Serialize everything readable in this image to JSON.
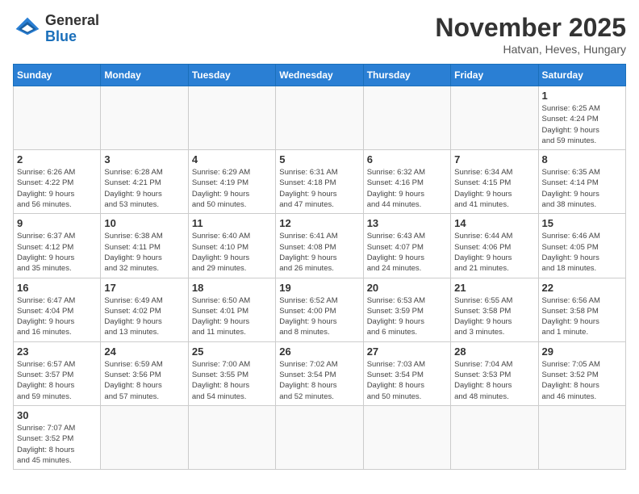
{
  "header": {
    "logo_general": "General",
    "logo_blue": "Blue",
    "month_year": "November 2025",
    "location": "Hatvan, Heves, Hungary"
  },
  "weekdays": [
    "Sunday",
    "Monday",
    "Tuesday",
    "Wednesday",
    "Thursday",
    "Friday",
    "Saturday"
  ],
  "weeks": [
    [
      {
        "day": "",
        "info": ""
      },
      {
        "day": "",
        "info": ""
      },
      {
        "day": "",
        "info": ""
      },
      {
        "day": "",
        "info": ""
      },
      {
        "day": "",
        "info": ""
      },
      {
        "day": "",
        "info": ""
      },
      {
        "day": "1",
        "info": "Sunrise: 6:25 AM\nSunset: 4:24 PM\nDaylight: 9 hours\nand 59 minutes."
      }
    ],
    [
      {
        "day": "2",
        "info": "Sunrise: 6:26 AM\nSunset: 4:22 PM\nDaylight: 9 hours\nand 56 minutes."
      },
      {
        "day": "3",
        "info": "Sunrise: 6:28 AM\nSunset: 4:21 PM\nDaylight: 9 hours\nand 53 minutes."
      },
      {
        "day": "4",
        "info": "Sunrise: 6:29 AM\nSunset: 4:19 PM\nDaylight: 9 hours\nand 50 minutes."
      },
      {
        "day": "5",
        "info": "Sunrise: 6:31 AM\nSunset: 4:18 PM\nDaylight: 9 hours\nand 47 minutes."
      },
      {
        "day": "6",
        "info": "Sunrise: 6:32 AM\nSunset: 4:16 PM\nDaylight: 9 hours\nand 44 minutes."
      },
      {
        "day": "7",
        "info": "Sunrise: 6:34 AM\nSunset: 4:15 PM\nDaylight: 9 hours\nand 41 minutes."
      },
      {
        "day": "8",
        "info": "Sunrise: 6:35 AM\nSunset: 4:14 PM\nDaylight: 9 hours\nand 38 minutes."
      }
    ],
    [
      {
        "day": "9",
        "info": "Sunrise: 6:37 AM\nSunset: 4:12 PM\nDaylight: 9 hours\nand 35 minutes."
      },
      {
        "day": "10",
        "info": "Sunrise: 6:38 AM\nSunset: 4:11 PM\nDaylight: 9 hours\nand 32 minutes."
      },
      {
        "day": "11",
        "info": "Sunrise: 6:40 AM\nSunset: 4:10 PM\nDaylight: 9 hours\nand 29 minutes."
      },
      {
        "day": "12",
        "info": "Sunrise: 6:41 AM\nSunset: 4:08 PM\nDaylight: 9 hours\nand 26 minutes."
      },
      {
        "day": "13",
        "info": "Sunrise: 6:43 AM\nSunset: 4:07 PM\nDaylight: 9 hours\nand 24 minutes."
      },
      {
        "day": "14",
        "info": "Sunrise: 6:44 AM\nSunset: 4:06 PM\nDaylight: 9 hours\nand 21 minutes."
      },
      {
        "day": "15",
        "info": "Sunrise: 6:46 AM\nSunset: 4:05 PM\nDaylight: 9 hours\nand 18 minutes."
      }
    ],
    [
      {
        "day": "16",
        "info": "Sunrise: 6:47 AM\nSunset: 4:04 PM\nDaylight: 9 hours\nand 16 minutes."
      },
      {
        "day": "17",
        "info": "Sunrise: 6:49 AM\nSunset: 4:02 PM\nDaylight: 9 hours\nand 13 minutes."
      },
      {
        "day": "18",
        "info": "Sunrise: 6:50 AM\nSunset: 4:01 PM\nDaylight: 9 hours\nand 11 minutes."
      },
      {
        "day": "19",
        "info": "Sunrise: 6:52 AM\nSunset: 4:00 PM\nDaylight: 9 hours\nand 8 minutes."
      },
      {
        "day": "20",
        "info": "Sunrise: 6:53 AM\nSunset: 3:59 PM\nDaylight: 9 hours\nand 6 minutes."
      },
      {
        "day": "21",
        "info": "Sunrise: 6:55 AM\nSunset: 3:58 PM\nDaylight: 9 hours\nand 3 minutes."
      },
      {
        "day": "22",
        "info": "Sunrise: 6:56 AM\nSunset: 3:58 PM\nDaylight: 9 hours\nand 1 minute."
      }
    ],
    [
      {
        "day": "23",
        "info": "Sunrise: 6:57 AM\nSunset: 3:57 PM\nDaylight: 8 hours\nand 59 minutes."
      },
      {
        "day": "24",
        "info": "Sunrise: 6:59 AM\nSunset: 3:56 PM\nDaylight: 8 hours\nand 57 minutes."
      },
      {
        "day": "25",
        "info": "Sunrise: 7:00 AM\nSunset: 3:55 PM\nDaylight: 8 hours\nand 54 minutes."
      },
      {
        "day": "26",
        "info": "Sunrise: 7:02 AM\nSunset: 3:54 PM\nDaylight: 8 hours\nand 52 minutes."
      },
      {
        "day": "27",
        "info": "Sunrise: 7:03 AM\nSunset: 3:54 PM\nDaylight: 8 hours\nand 50 minutes."
      },
      {
        "day": "28",
        "info": "Sunrise: 7:04 AM\nSunset: 3:53 PM\nDaylight: 8 hours\nand 48 minutes."
      },
      {
        "day": "29",
        "info": "Sunrise: 7:05 AM\nSunset: 3:52 PM\nDaylight: 8 hours\nand 46 minutes."
      }
    ],
    [
      {
        "day": "30",
        "info": "Sunrise: 7:07 AM\nSunset: 3:52 PM\nDaylight: 8 hours\nand 45 minutes."
      },
      {
        "day": "",
        "info": ""
      },
      {
        "day": "",
        "info": ""
      },
      {
        "day": "",
        "info": ""
      },
      {
        "day": "",
        "info": ""
      },
      {
        "day": "",
        "info": ""
      },
      {
        "day": "",
        "info": ""
      }
    ]
  ]
}
